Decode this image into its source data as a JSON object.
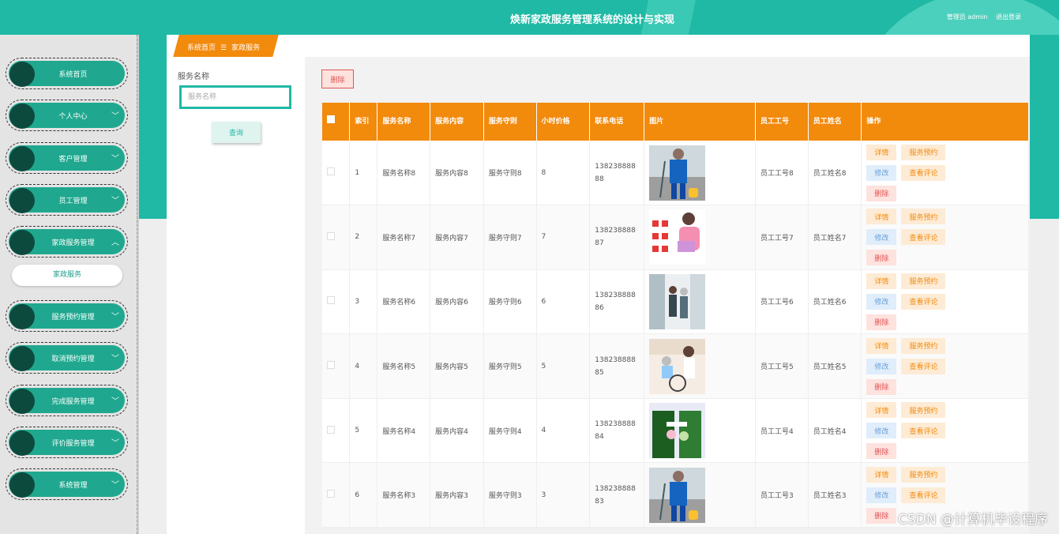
{
  "header": {
    "title": "焕新家政服务管理系统的设计与实现",
    "user_label": "管理员 admin",
    "logout_label": "退出登录"
  },
  "sidebar": {
    "items": [
      {
        "label": "系统首页",
        "has_chevron": false
      },
      {
        "label": "个人中心",
        "has_chevron": true
      },
      {
        "label": "客户管理",
        "has_chevron": true
      },
      {
        "label": "员工管理",
        "has_chevron": true
      },
      {
        "label": "家政服务管理",
        "has_chevron": true,
        "expanded": true
      },
      {
        "label": "服务预约管理",
        "has_chevron": true
      },
      {
        "label": "取消预约管理",
        "has_chevron": true
      },
      {
        "label": "完成服务管理",
        "has_chevron": true
      },
      {
        "label": "评价服务管理",
        "has_chevron": true
      },
      {
        "label": "系统管理",
        "has_chevron": true
      }
    ],
    "submenu_label": "家政服务"
  },
  "breadcrumb": {
    "home": "系统首页",
    "separator": "☰",
    "current": "家政服务"
  },
  "search": {
    "label": "服务名称",
    "placeholder": "服务名称",
    "button": "查询"
  },
  "toolbar": {
    "delete_label": "删除"
  },
  "table": {
    "headers": [
      "索引",
      "服务名称",
      "服务内容",
      "服务守则",
      "小时价格",
      "联系电话",
      "图片",
      "员工工号",
      "员工姓名",
      "操作"
    ],
    "rows": [
      {
        "index": "1",
        "name": "服务名称8",
        "content": "服务内容8",
        "rules": "服务守则8",
        "price": "8",
        "phone": "13823888888",
        "image": "cleaning-worker-vacuum",
        "emp_no": "员工工号8",
        "emp_name": "员工姓名8"
      },
      {
        "index": "2",
        "name": "服务名称7",
        "content": "服务内容7",
        "rules": "服务守则7",
        "price": "7",
        "phone": "13823888887",
        "image": "housekeeper-poster",
        "emp_no": "员工工号7",
        "emp_name": "员工姓名7"
      },
      {
        "index": "3",
        "name": "服务名称6",
        "content": "服务内容6",
        "rules": "服务守则6",
        "price": "6",
        "phone": "13823888886",
        "image": "elderly-care-walk",
        "emp_no": "员工工号6",
        "emp_name": "员工姓名6"
      },
      {
        "index": "4",
        "name": "服务名称5",
        "content": "服务内容5",
        "rules": "服务守则5",
        "price": "5",
        "phone": "13823888885",
        "image": "wheelchair-care",
        "emp_no": "员工工号5",
        "emp_name": "员工姓名5"
      },
      {
        "index": "5",
        "name": "服务名称4",
        "content": "服务内容4",
        "rules": "服务守则4",
        "price": "4",
        "phone": "13823888884",
        "image": "cleaners-apron",
        "emp_no": "员工工号4",
        "emp_name": "员工姓名4"
      },
      {
        "index": "6",
        "name": "服务名称3",
        "content": "服务内容3",
        "rules": "服务守则3",
        "price": "3",
        "phone": "13823888883",
        "image": "cleaning-worker-vacuum",
        "emp_no": "员工工号3",
        "emp_name": "员工姓名3"
      }
    ],
    "actions": {
      "detail": "详情",
      "book": "服务预约",
      "edit": "修改",
      "review": "查看评论",
      "delete": "删除"
    }
  },
  "watermark": "CSDN @计算机毕设程序",
  "colors": {
    "primary": "#1fb9a5",
    "accent": "#f28a0c",
    "sidebar_pill": "#1fa88f",
    "knob": "#0d4a3e"
  }
}
